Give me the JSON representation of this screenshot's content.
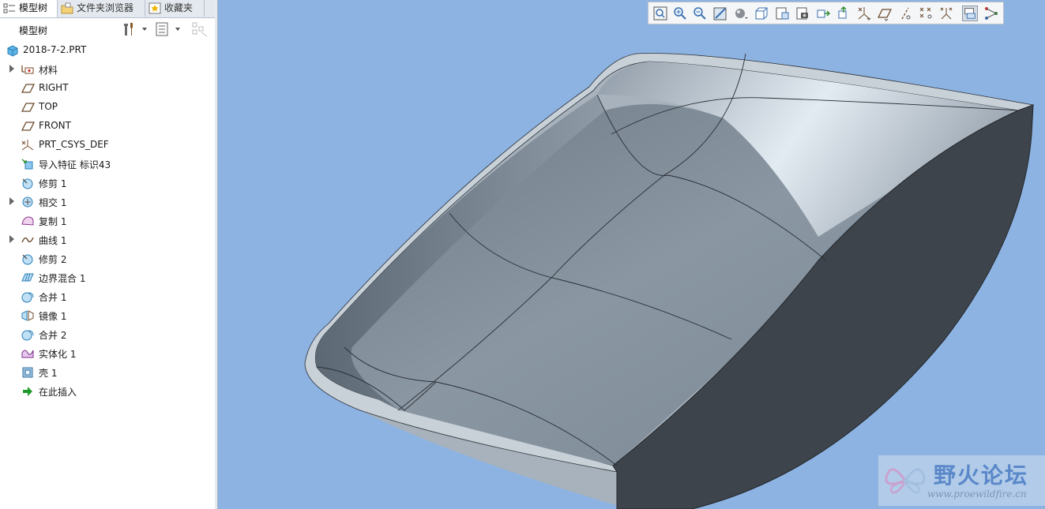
{
  "tabs": [
    {
      "label": "模型树",
      "icon": "model-tree-icon"
    },
    {
      "label": "文件夹浏览器",
      "icon": "folder-browser-icon"
    },
    {
      "label": "收藏夹",
      "icon": "favorites-icon"
    }
  ],
  "panel": {
    "title": "模型树"
  },
  "tree": {
    "root": "2018-7-2.PRT",
    "items": [
      {
        "label": "材料",
        "icon": "material-icon",
        "expandable": true
      },
      {
        "label": "RIGHT",
        "icon": "datum-plane-icon",
        "expandable": false
      },
      {
        "label": "TOP",
        "icon": "datum-plane-icon",
        "expandable": false
      },
      {
        "label": "FRONT",
        "icon": "datum-plane-icon",
        "expandable": false
      },
      {
        "label": "PRT_CSYS_DEF",
        "icon": "csys-icon",
        "expandable": false
      },
      {
        "label": "导入特征 标识43",
        "icon": "import-feature-icon",
        "expandable": false
      },
      {
        "label": "修剪 1",
        "icon": "trim-icon",
        "expandable": false
      },
      {
        "label": "相交 1",
        "icon": "intersect-icon",
        "expandable": true
      },
      {
        "label": "复制 1",
        "icon": "copy-icon",
        "expandable": false
      },
      {
        "label": "曲线 1",
        "icon": "curve-icon",
        "expandable": true
      },
      {
        "label": "修剪 2",
        "icon": "trim-icon",
        "expandable": false
      },
      {
        "label": "边界混合 1",
        "icon": "boundary-blend-icon",
        "expandable": false
      },
      {
        "label": "合并 1",
        "icon": "merge-icon",
        "expandable": false
      },
      {
        "label": "镜像 1",
        "icon": "mirror-icon",
        "expandable": false
      },
      {
        "label": "合并 2",
        "icon": "merge-icon",
        "expandable": false
      },
      {
        "label": "实体化 1",
        "icon": "solidify-icon",
        "expandable": false
      },
      {
        "label": "壳 1",
        "icon": "shell-icon",
        "expandable": false
      },
      {
        "label": "在此插入",
        "icon": "insert-here-icon",
        "expandable": false
      }
    ]
  },
  "watermark": {
    "title": "野火论坛",
    "url": "www.proewildfire.cn"
  },
  "colors": {
    "background": "#8db3e2",
    "part_body": "#7d8a96",
    "part_side": "#3d434a"
  }
}
